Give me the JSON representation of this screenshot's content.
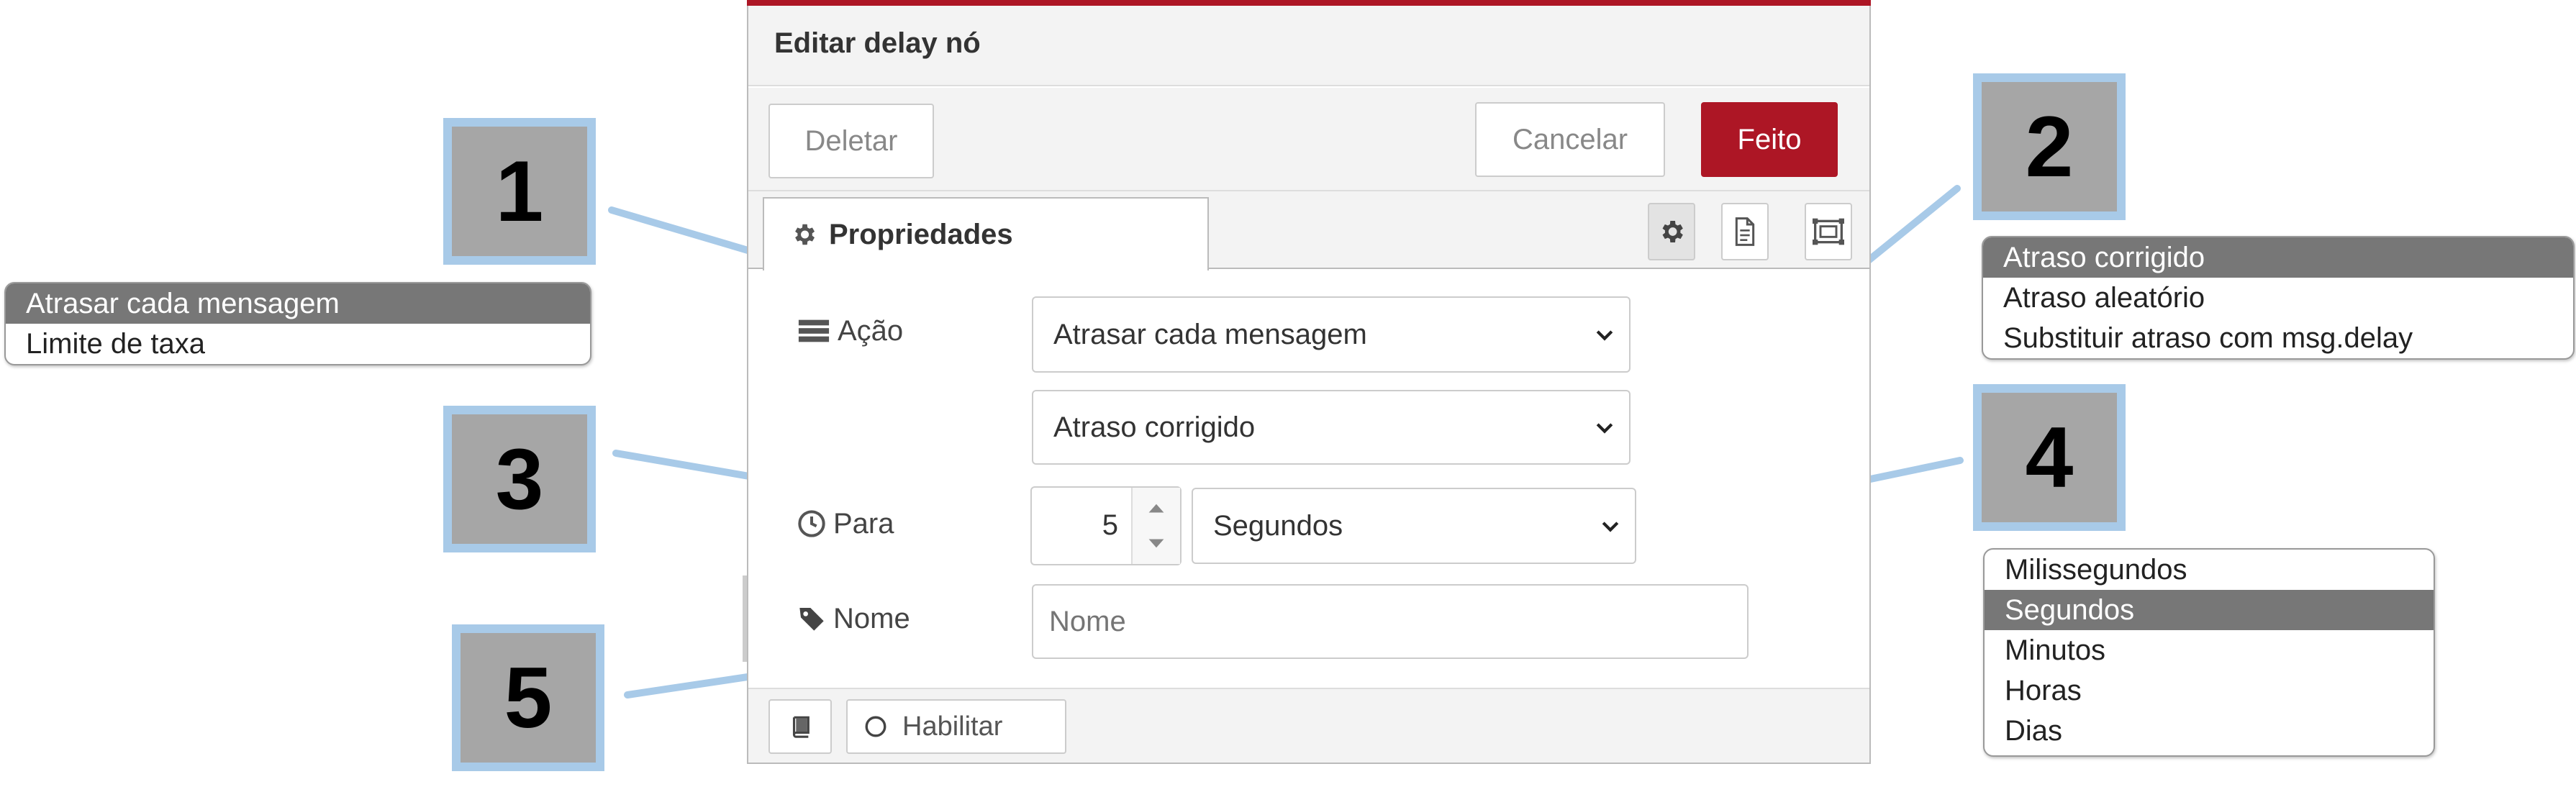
{
  "dialog": {
    "title": "Editar delay nó",
    "buttons": {
      "delete": "Deletar",
      "cancel": "Cancelar",
      "done": "Feito"
    },
    "tab": {
      "label": "Propriedades"
    },
    "form": {
      "action_label": "Ação",
      "action_value": "Atrasar cada mensagem",
      "delay_type_value": "Atraso corrigido",
      "for_label": "Para",
      "for_value": "5",
      "unit_value": "Segundos",
      "name_label": "Nome",
      "name_placeholder": "Nome",
      "name_value": ""
    },
    "footer": {
      "enable_label": "Habilitar"
    }
  },
  "callouts": [
    "1",
    "2",
    "3",
    "4",
    "5"
  ],
  "action_options": {
    "items": [
      "Atrasar cada mensagem",
      "Limite de taxa"
    ],
    "selected": "Atrasar cada mensagem"
  },
  "delay_type_options": {
    "items": [
      "Atraso corrigido",
      "Atraso aleatório",
      "Substituir atraso com msg.delay"
    ],
    "selected": "Atraso corrigido"
  },
  "unit_options": {
    "items": [
      "Milissegundos",
      "Segundos",
      "Minutos",
      "Horas",
      "Dias"
    ],
    "selected": "Segundos"
  },
  "colors": {
    "accent": "#ad1625",
    "callout_border": "#a8cae8",
    "callout_fill": "#a6a6a6",
    "selected_option": "#777777"
  },
  "icons": [
    "cog-icon",
    "document-icon",
    "frame-icon",
    "list-icon",
    "clock-icon",
    "tag-icon",
    "book-icon",
    "circle-icon",
    "chevron-down-icon"
  ]
}
